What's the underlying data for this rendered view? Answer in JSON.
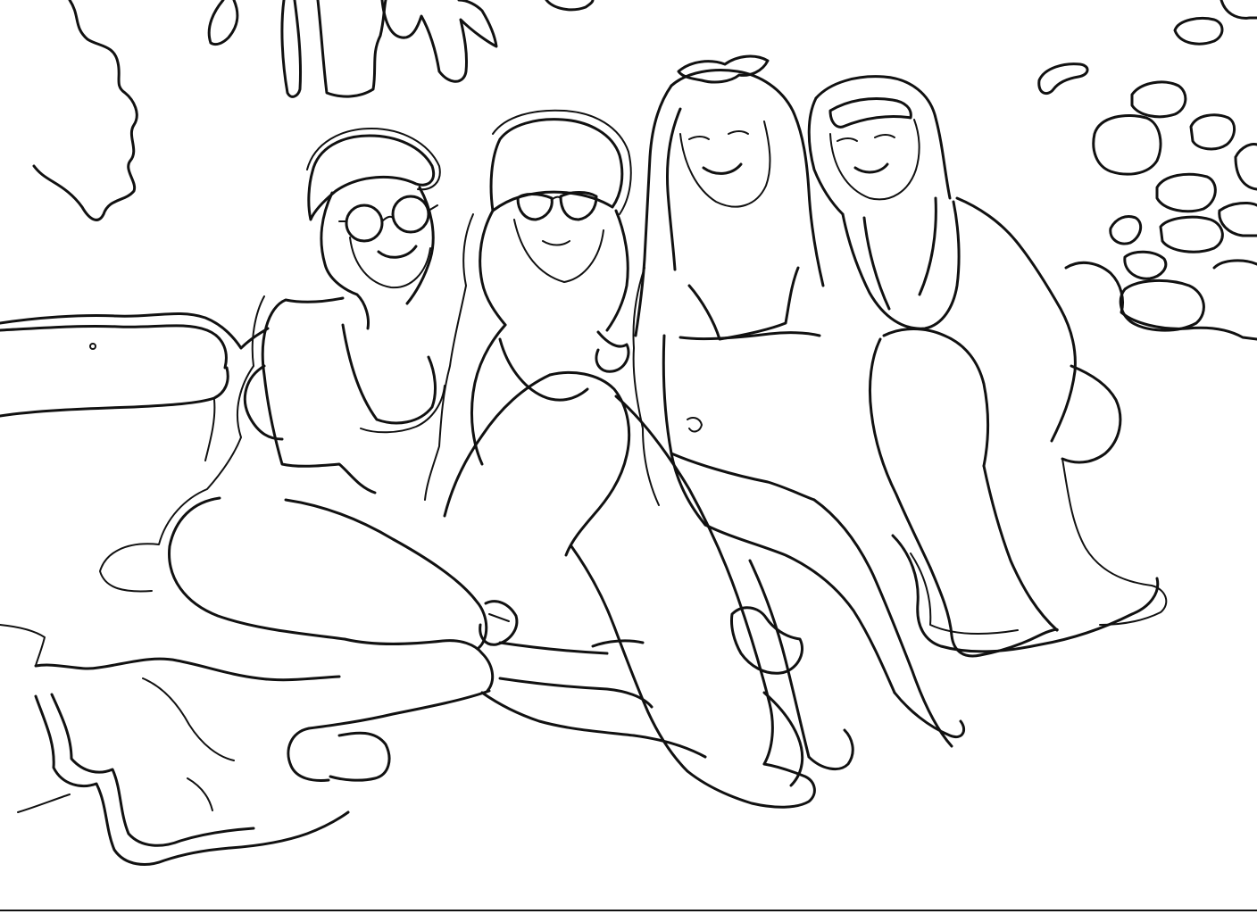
{
  "image": {
    "style": "black line-art coloring page",
    "colors": {
      "background": "#ffffff",
      "line": "#111111"
    },
    "figures": [
      {
        "id": "person-1",
        "accessories": [
          "round-glasses",
          "bucket-hat"
        ],
        "pose": "sitting-legs-crossed"
      },
      {
        "id": "person-2",
        "accessories": [
          "sunglasses",
          "bucket-hat"
        ],
        "pose": "sitting-knee-raised"
      },
      {
        "id": "person-3",
        "accessories": [
          "sunglasses-on-head"
        ],
        "pose": "sitting-legs-forward"
      },
      {
        "id": "person-4",
        "accessories": [
          "headband"
        ],
        "pose": "crouching"
      }
    ]
  }
}
